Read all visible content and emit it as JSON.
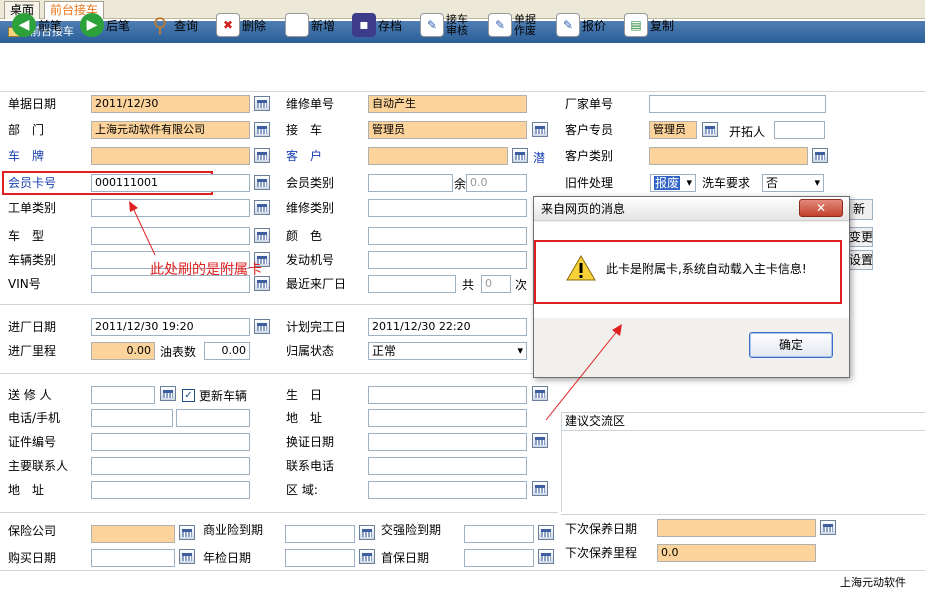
{
  "tabs": [
    {
      "label": "桌面"
    },
    {
      "label": "前台接车"
    }
  ],
  "window_title": "前台接车",
  "toolbar": {
    "prev": "前笔",
    "next": "后笔",
    "query": "查询",
    "delete": "删除",
    "new": "新增",
    "save": "存档",
    "reception_audit": "接车审核",
    "voucher_void": "单据作废",
    "quote": "报价",
    "copy": "复制"
  },
  "labels": {
    "doc_date": "单据日期",
    "repair_no": "维修单号",
    "factory_no": "厂家单号",
    "dept": "部　门",
    "receiver": "接　车",
    "customer_rep": "客户专员",
    "developer": "开拓人",
    "plate": "车　牌",
    "customer": "客　户",
    "qian": "潜",
    "customer_type": "客户类别",
    "member_card": "会员卡号",
    "member_type": "会员类别",
    "balance_prefix": "余",
    "old_handling": "旧件处理",
    "wash_req": "洗车要求",
    "job_type": "工单类别",
    "repair_type": "维修类别",
    "car_model": "车　型",
    "color": "颜　色",
    "vehicle_type": "车辆类别",
    "engine_no": "发动机号",
    "vin": "VIN号",
    "last_visit": "最近来厂日",
    "total_prefix": "共",
    "times_suffix": "次",
    "in_date": "进厂日期",
    "plan_done": "计划完工日",
    "in_mileage": "进厂里程",
    "fuel": "油表数",
    "ownership": "归属状态",
    "sender": "送 修 人",
    "update_vehicle": "更新车辆",
    "birthday": "生　日",
    "phone": "电话/手机",
    "address_right": "地　址",
    "id_no": "证件编号",
    "license_date": "换证日期",
    "main_contact": "主要联系人",
    "contact_phone": "联系电话",
    "address": "地　址",
    "area": "区 域:",
    "suggestion": "建议交流区",
    "insurer": "保险公司",
    "commercial_expiry": "商业险到期",
    "compulsory_expiry": "交强险到期",
    "purchase_date": "购买日期",
    "inspection_date": "年检日期",
    "first_warranty": "首保日期",
    "next_service_date": "下次保养日期",
    "next_service_mileage": "下次保养里程",
    "right_btn1": "新",
    "right_btn2": "变更",
    "right_btn3": "设置"
  },
  "values": {
    "doc_date": "2011/12/30",
    "repair_no": "自动产生",
    "dept": "上海元动软件有限公司",
    "receiver": "管理员",
    "customer_rep": "管理员",
    "member_card": "000111001",
    "balance": "0.0",
    "old_handling": "报废",
    "wash_req": "否",
    "visit_count": "0",
    "in_date": "2011/12/30 19:20",
    "plan_done": "2011/12/30 22:20",
    "in_mileage": "0.00",
    "fuel": "0.00",
    "ownership": "正常",
    "next_service_mileage": "0.0"
  },
  "annotation": "此处刷的是附属卡",
  "dialog": {
    "title": "来自网页的消息",
    "close": "✕",
    "message": "此卡是附属卡,系统自动载入主卡信息!",
    "ok": "确定"
  },
  "footer": "上海元动软件",
  "colors": {
    "highlight": "#fcd39a",
    "title_bar": "#2a5d98",
    "annotation_red": "#e02020"
  }
}
